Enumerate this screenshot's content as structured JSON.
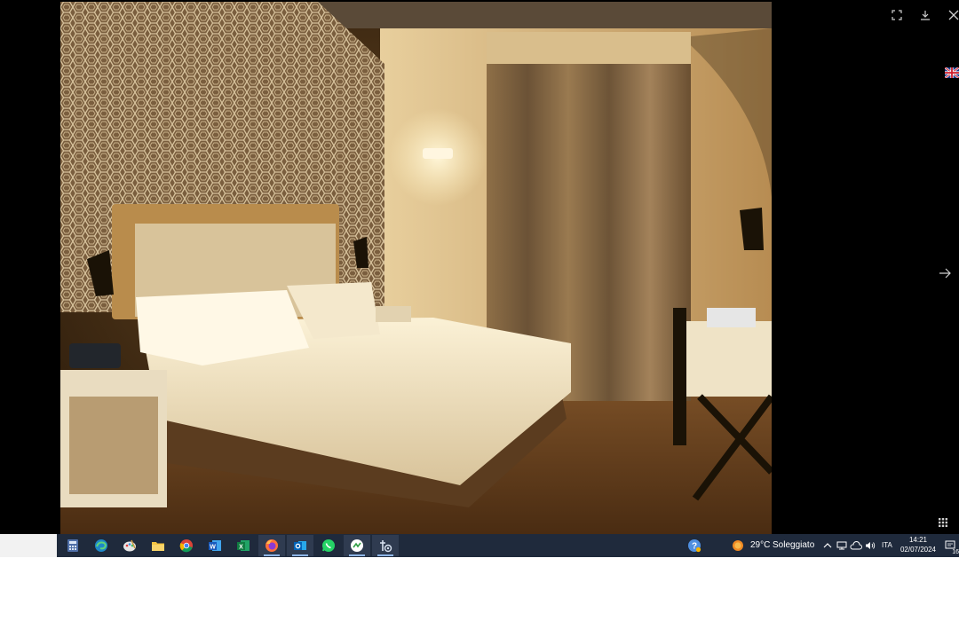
{
  "viewer": {
    "photo_alt": "Hotel room with bed, lamps and curtains",
    "controls": {
      "fullscreen_icon": "fullscreen-icon",
      "download_icon": "download-icon",
      "close_icon": "close-icon",
      "next_icon": "arrow-right-icon",
      "grid_icon": "grid-icon",
      "language_icon": "uk-flag-icon"
    }
  },
  "taskbar": {
    "apps": [
      {
        "name": "calculator",
        "icon": "calculator-icon"
      },
      {
        "name": "edge",
        "icon": "edge-icon"
      },
      {
        "name": "paint",
        "icon": "paint-icon"
      },
      {
        "name": "file-explorer",
        "icon": "folder-icon"
      },
      {
        "name": "chrome",
        "icon": "chrome-icon"
      },
      {
        "name": "word",
        "icon": "word-icon"
      },
      {
        "name": "excel",
        "icon": "excel-icon"
      },
      {
        "name": "firefox",
        "icon": "firefox-icon"
      },
      {
        "name": "outlook",
        "icon": "outlook-icon"
      },
      {
        "name": "whatsapp",
        "icon": "whatsapp-icon"
      },
      {
        "name": "app-green",
        "icon": "app-icon"
      },
      {
        "name": "app-settings",
        "icon": "settings-app-icon"
      }
    ],
    "weather": {
      "temp": "29°C",
      "condition": "Soleggiato"
    },
    "tray": {
      "language": "ITA",
      "notification_count": "16"
    },
    "clock": {
      "time": "14:21",
      "date": "02/07/2024"
    }
  },
  "colors": {
    "taskbar_bg": "#1f2a3c",
    "viewer_bg": "#000000"
  }
}
